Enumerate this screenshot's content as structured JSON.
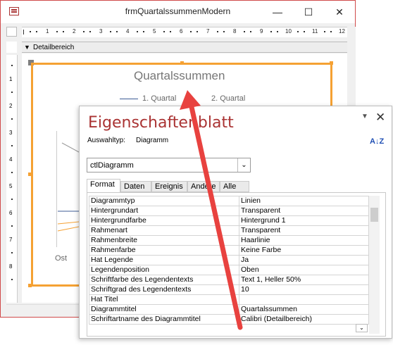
{
  "window": {
    "title": "frmQuartalssummenModern",
    "minimize": "—",
    "maximize": "☐",
    "close": "✕"
  },
  "ruler": {
    "numbers": [
      "1",
      "2",
      "3",
      "4",
      "5",
      "6",
      "7",
      "8",
      "9",
      "10",
      "11",
      "12"
    ]
  },
  "vruler": {
    "numbers": [
      "1",
      "2",
      "3",
      "4",
      "5",
      "6",
      "7",
      "8"
    ]
  },
  "section": {
    "label": "Detailbereich"
  },
  "chart": {
    "title": "Quartalssummen",
    "legend": [
      "1. Quartal",
      "2. Quartal"
    ],
    "category": "Ost",
    "colors": {
      "frame": "#f5a133",
      "series1": "#3c5b94",
      "series2": "#f5a133"
    }
  },
  "property_sheet": {
    "title": "Eigenschaftenblatt",
    "selection_label": "Auswahltyp:",
    "selection_type": "Diagramm",
    "combo_value": "ctlDiagramm",
    "tabs": [
      "Format",
      "Daten",
      "Ereignis",
      "Andere",
      "Alle"
    ],
    "active_tab": "Format",
    "properties": [
      {
        "name": "Diagrammtyp",
        "value": "Linien"
      },
      {
        "name": "Hintergrundart",
        "value": "Transparent"
      },
      {
        "name": "Hintergrundfarbe",
        "value": "Hintergrund 1"
      },
      {
        "name": "Rahmenart",
        "value": "Transparent"
      },
      {
        "name": "Rahmenbreite",
        "value": "Haarlinie"
      },
      {
        "name": "Rahmenfarbe",
        "value": "Keine Farbe"
      },
      {
        "name": "Hat Legende",
        "value": "Ja"
      },
      {
        "name": "Legendenposition",
        "value": "Oben"
      },
      {
        "name": "Schriftfarbe des Legendentexts",
        "value": "Text 1, Heller 50%"
      },
      {
        "name": "Schriftgrad des Legendentexts",
        "value": "10"
      },
      {
        "name": "Hat Titel",
        "value": ""
      },
      {
        "name": "Diagrammtitel",
        "value": "Quartalssummen"
      },
      {
        "name": "Schriftartname des Diagrammtitel",
        "value": "Calibri (Detailbereich)"
      }
    ],
    "accent_color": "#a33333"
  },
  "annotation": {
    "arrow_color": "#e8423f"
  }
}
